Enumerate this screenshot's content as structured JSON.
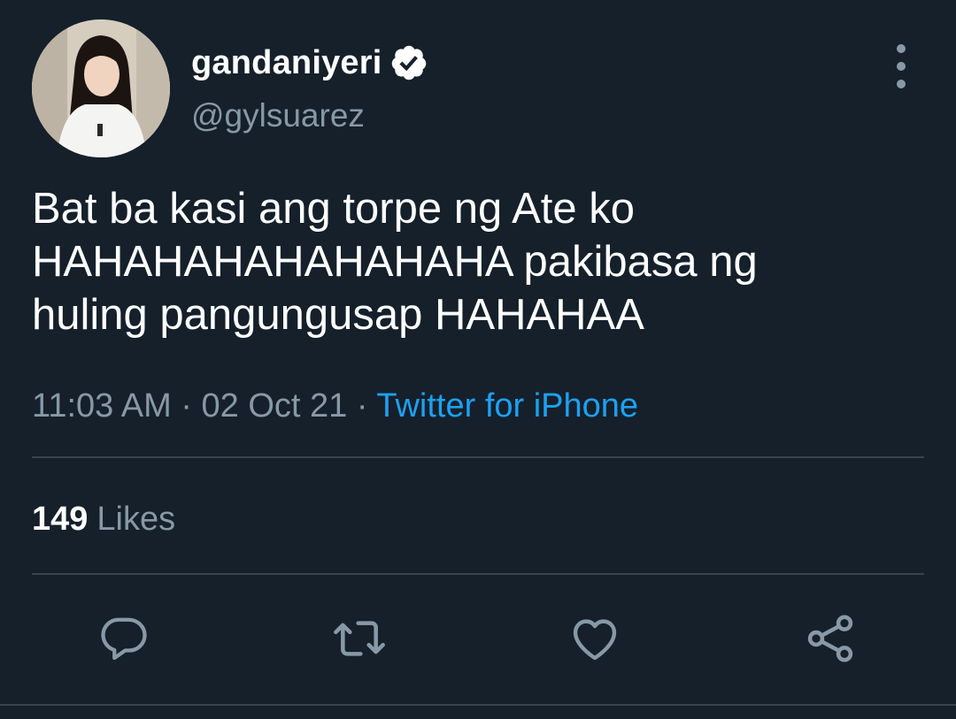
{
  "user": {
    "display_name": "gandaniyeri",
    "handle": "@gylsuarez",
    "verified": true
  },
  "tweet": {
    "lines": [
      "Bat ba kasi ang torpe ng Ate ko",
      "HAHAHAHAHAHAHAHA pakibasa ng",
      "huling pangungusap HAHAHAA"
    ],
    "time": "11:03 AM",
    "separator": "·",
    "date": "02 Oct 21",
    "source": "Twitter for iPhone"
  },
  "stats": {
    "likes_count": "149",
    "likes_label": "Likes"
  },
  "actions": [
    "reply-icon",
    "retweet-icon",
    "like-icon",
    "share-icon"
  ],
  "colors": {
    "background": "#15202b",
    "primary_text": "#ffffff",
    "secondary_text": "#8899a6",
    "accent": "#1da1f2",
    "divider": "#38444d"
  }
}
